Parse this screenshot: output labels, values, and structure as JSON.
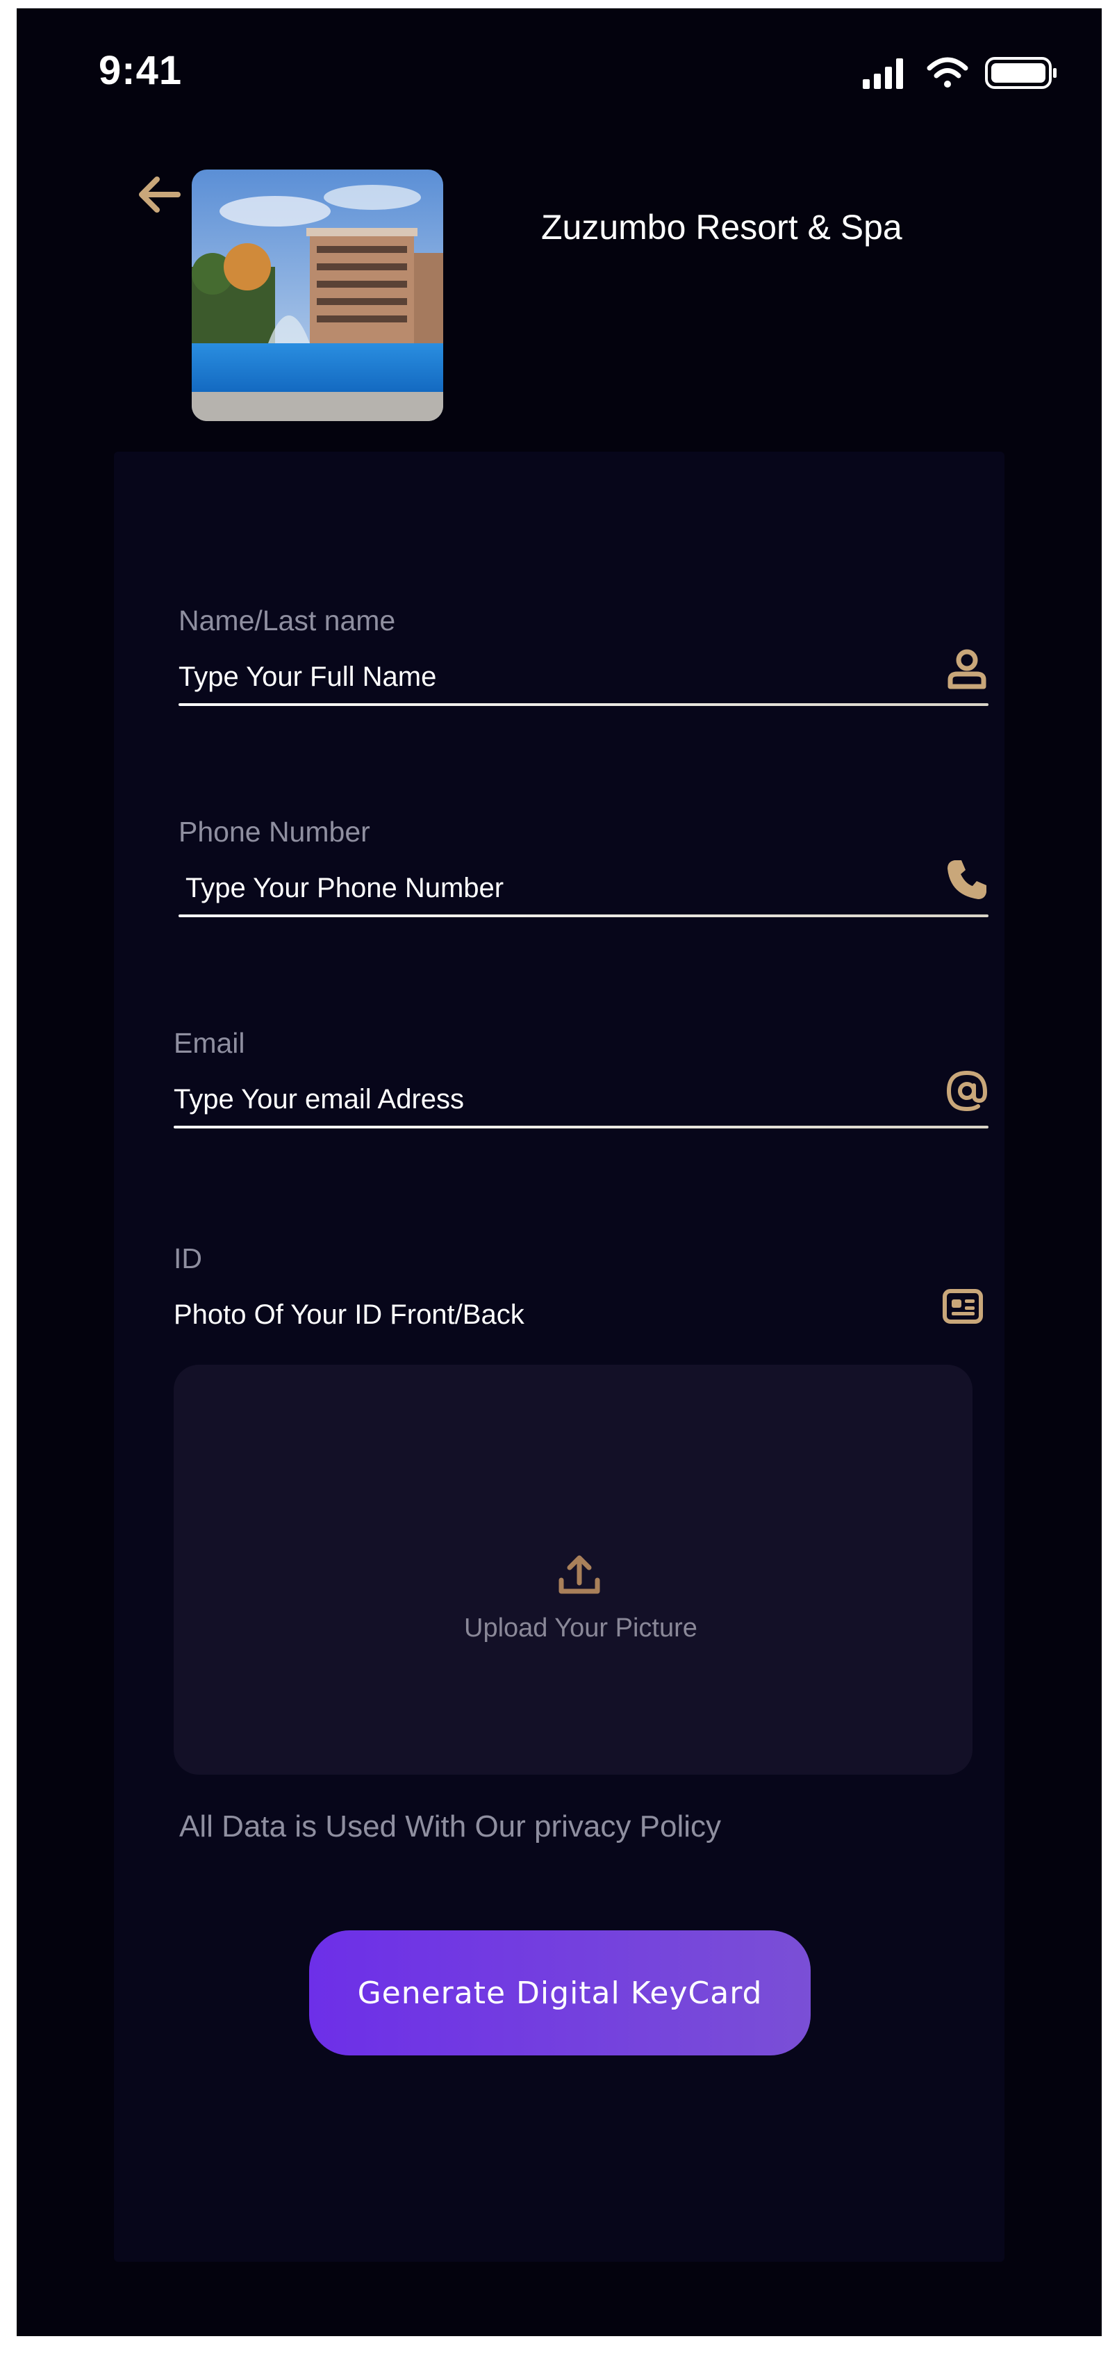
{
  "status_bar": {
    "time": "9:41"
  },
  "header": {
    "hotel_name": "Zuzumbo Resort & Spa"
  },
  "form": {
    "name": {
      "label": "Name/Last name",
      "placeholder": "Type Your Full Name",
      "icon": "user-icon"
    },
    "phone": {
      "label": "Phone Number",
      "placeholder": "Type Your Phone Number",
      "icon": "phone-icon"
    },
    "email": {
      "label": "Email",
      "placeholder": "Type Your email Adress",
      "icon": "at-icon"
    },
    "id": {
      "label": "ID",
      "hint": "Photo Of Your ID Front/Back",
      "icon": "id-card-icon"
    },
    "upload": {
      "label": "Upload Your Picture",
      "icon": "upload-icon"
    },
    "privacy_note": "All Data is Used With Our privacy Policy",
    "submit_label": "Generate Digital KeyCard"
  },
  "colors": {
    "background": "#03020d",
    "card": "#07061a",
    "accent_gold": "#c9a77a",
    "button_start": "#6d2fe8",
    "button_end": "#7a4fd6",
    "upload_box": "#131027"
  }
}
